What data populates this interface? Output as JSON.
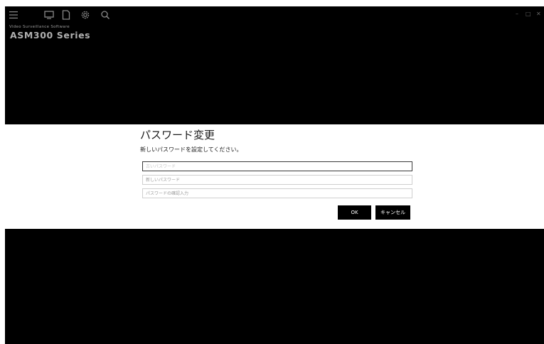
{
  "app": {
    "brand_subtitle": "Video Surveillance Software",
    "brand_title": "ASM300 Series"
  },
  "toolbar": {
    "icons": [
      "menu-icon",
      "monitor-icon",
      "file-icon",
      "gear-icon",
      "search-icon"
    ]
  },
  "window_controls": {
    "minimize": "–",
    "maximize": "□",
    "close": "✕"
  },
  "dialog": {
    "title": "パスワード変更",
    "message": "新しいパスワードを設定してください。",
    "fields": [
      {
        "placeholder": "古いパスワード",
        "value": ""
      },
      {
        "placeholder": "新しいパスワード",
        "value": ""
      },
      {
        "placeholder": "パスワードの確認入力",
        "value": ""
      }
    ],
    "ok_label": "OK",
    "cancel_label": "キャンセル"
  },
  "colors": {
    "background": "#000000",
    "dialog_background": "#ffffff",
    "button_background": "#000000",
    "icon_color": "#8a8a8a"
  }
}
